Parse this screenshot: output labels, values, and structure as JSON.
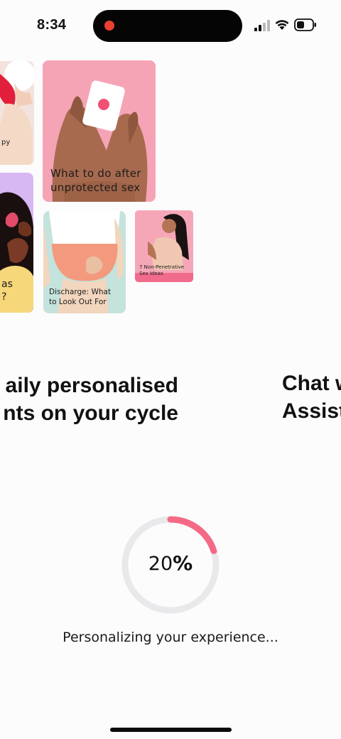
{
  "status_bar": {
    "time": "8:34",
    "icons": [
      "recording-dot-icon",
      "cellular-signal-icon",
      "wifi-icon",
      "battery-icon"
    ],
    "recording_color": "#e9412e"
  },
  "cards": {
    "red": {
      "label": "py"
    },
    "purple": {
      "label_line1": "as",
      "label_line2": "?"
    },
    "main": {
      "label_line1": "What to do after",
      "label_line2": "unprotected sex"
    },
    "teal": {
      "label_line1": "Discharge: What",
      "label_line2": "to Look Out For"
    },
    "small": {
      "label_line1": "7 Non-Penetrative",
      "label_line2": "Sex Ideas"
    }
  },
  "slides": {
    "current": {
      "line1": "aily personalised",
      "line2": "nts on your cycle"
    },
    "next": {
      "line1": "Chat w",
      "line2": "Assist"
    }
  },
  "progress": {
    "value": 20,
    "number": "20",
    "sign": "%",
    "track_color": "#e9e8ea",
    "fill_color": "#f46a86",
    "message": "Personalizing your experience..."
  }
}
